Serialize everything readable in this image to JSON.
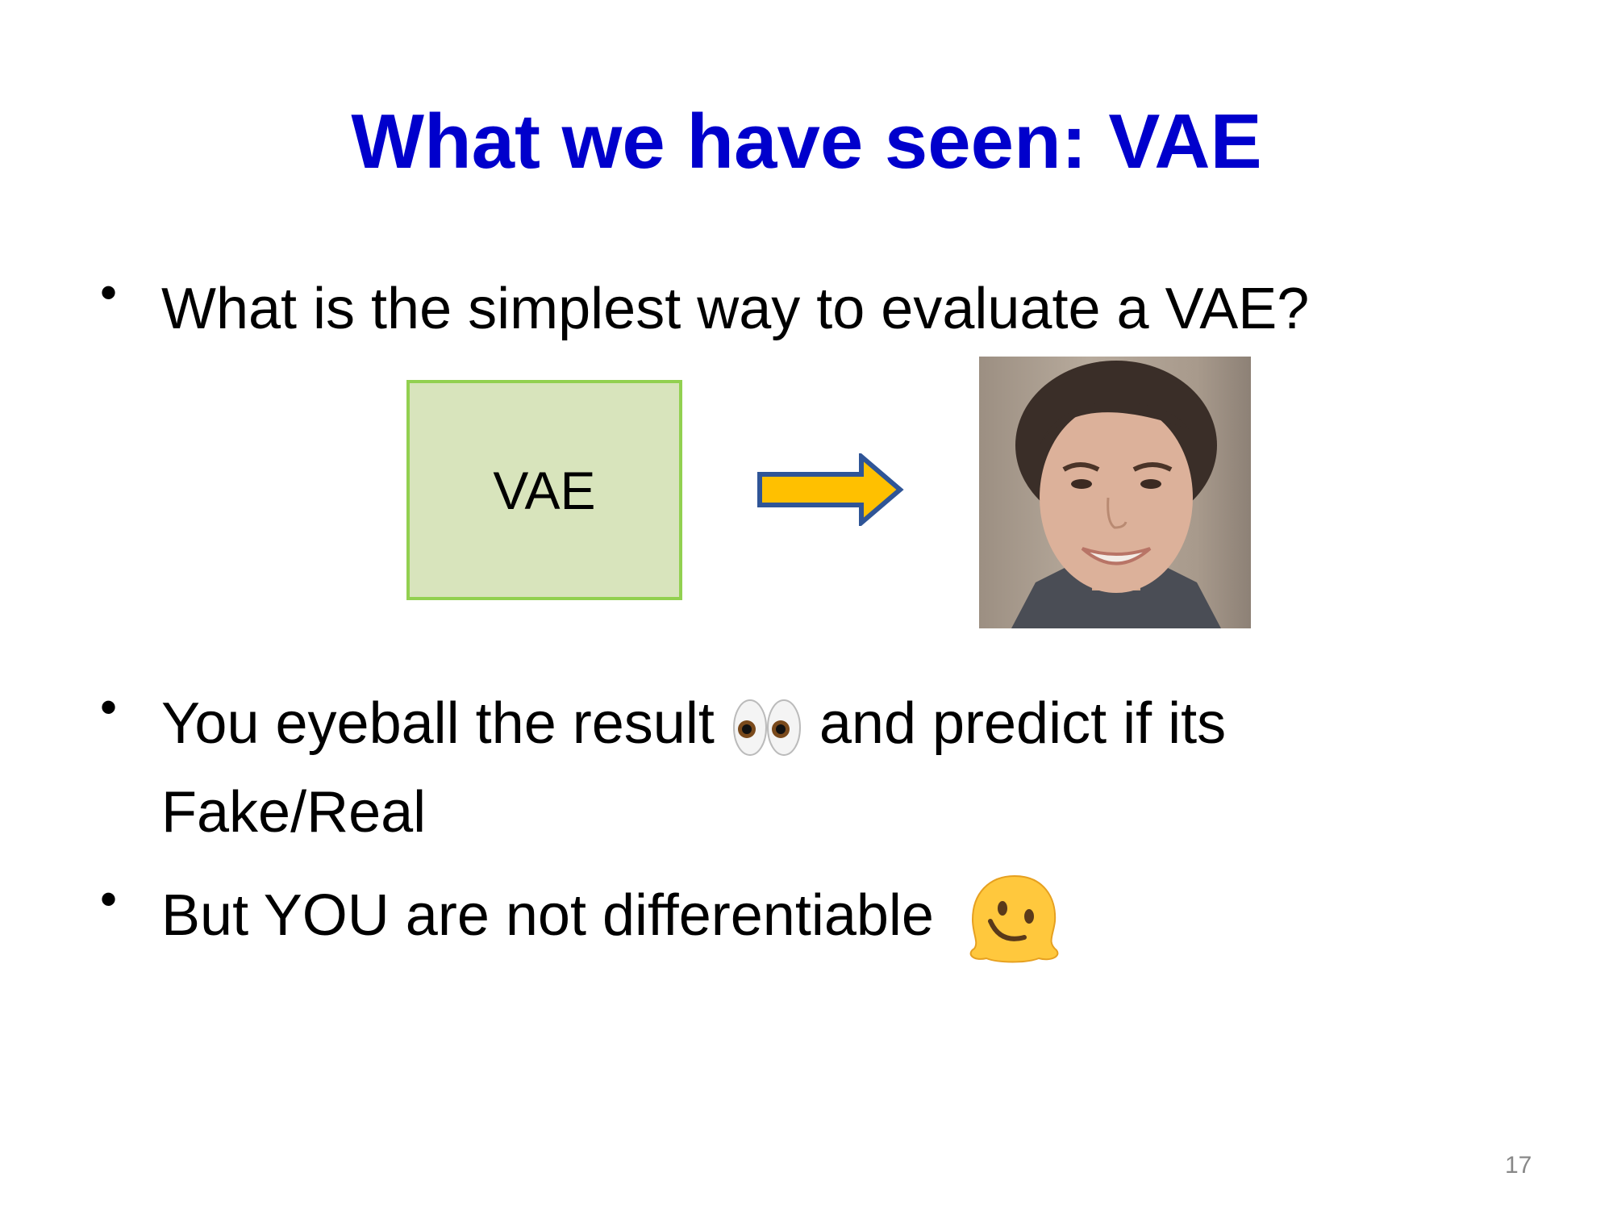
{
  "slide": {
    "title": "What we have seen: VAE",
    "bullets": [
      {
        "text": "What is the simplest way to evaluate a VAE?"
      },
      {
        "text_before": "You eyeball the result",
        "emoji": "eyes-emoji",
        "text_after": "and predict if its",
        "text_line2": "Fake/Real"
      },
      {
        "text": "But YOU are not differentiable",
        "emoji": "melting-face-emoji"
      }
    ],
    "diagram": {
      "box_label": "VAE",
      "box_fill": "#d8e4bc",
      "box_border": "#92d050",
      "arrow_fill": "#ffc000",
      "arrow_border": "#2f5597",
      "output_image": "face-photo"
    },
    "page_number": "17",
    "title_color": "#0000cc"
  }
}
